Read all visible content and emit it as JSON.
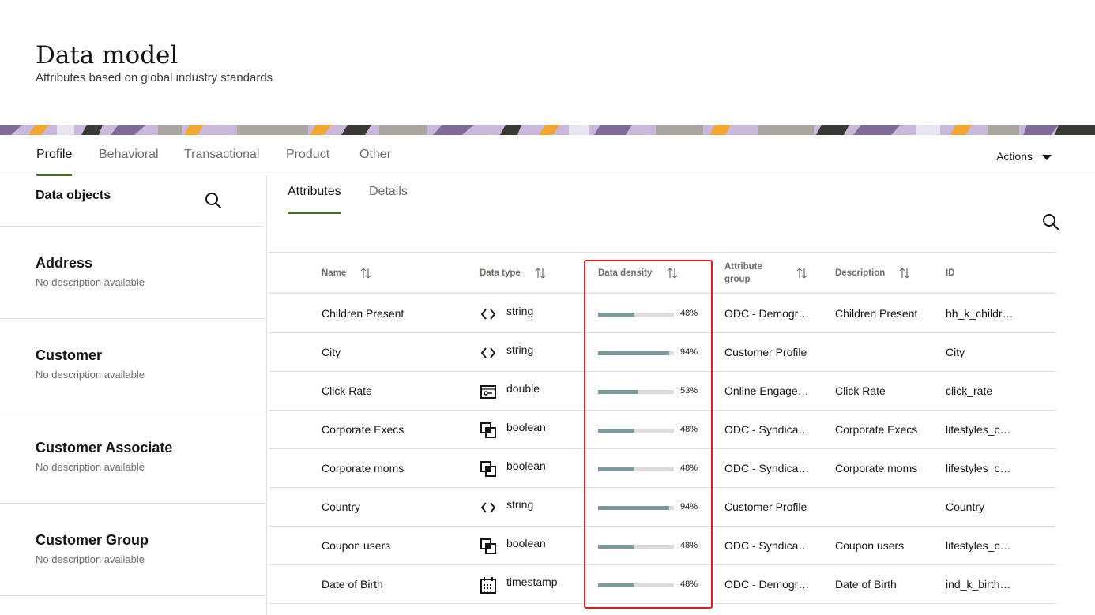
{
  "header": {
    "title": "Data model",
    "subtitle": "Attributes based on global industry standards"
  },
  "top_tabs": [
    {
      "label": "Profile",
      "active": true
    },
    {
      "label": "Behavioral",
      "active": false
    },
    {
      "label": "Transactional",
      "active": false
    },
    {
      "label": "Product",
      "active": false
    },
    {
      "label": "Other",
      "active": false
    }
  ],
  "actions_label": "Actions",
  "sidebar": {
    "title": "Data objects",
    "items": [
      {
        "name": "Address",
        "description": "No description available"
      },
      {
        "name": "Customer",
        "description": "No description available"
      },
      {
        "name": "Customer Associate",
        "description": "No description available"
      },
      {
        "name": "Customer Group",
        "description": "No description available"
      }
    ]
  },
  "sub_tabs": [
    {
      "label": "Attributes",
      "active": true
    },
    {
      "label": "Details",
      "active": false
    }
  ],
  "table": {
    "columns": {
      "name": "Name",
      "data_type": "Data type",
      "data_density": "Data density",
      "attribute_group_1": "Attribute",
      "attribute_group_2": "group",
      "description": "Description",
      "id": "ID"
    },
    "rows": [
      {
        "name": "Children Present",
        "type": "string",
        "type_icon": "code-icon",
        "density": 48,
        "density_label": "48%",
        "group": "ODC - Demogr…",
        "description": "Children Present",
        "id": "hh_k_childr…"
      },
      {
        "name": "City",
        "type": "string",
        "type_icon": "code-icon",
        "density": 94,
        "density_label": "94%",
        "group": "Customer Profile",
        "description": "",
        "id": "City"
      },
      {
        "name": "Click Rate",
        "type": "double",
        "type_icon": "number-icon",
        "density": 53,
        "density_label": "53%",
        "group": "Online Engage…",
        "description": "Click Rate",
        "id": "click_rate"
      },
      {
        "name": "Corporate Execs",
        "type": "boolean",
        "type_icon": "boolean-icon",
        "density": 48,
        "density_label": "48%",
        "group": "ODC - Syndica…",
        "description": "Corporate Execs",
        "id": "lifestyles_c…"
      },
      {
        "name": "Corporate moms",
        "type": "boolean",
        "type_icon": "boolean-icon",
        "density": 48,
        "density_label": "48%",
        "group": "ODC - Syndica…",
        "description": "Corporate moms",
        "id": "lifestyles_c…"
      },
      {
        "name": "Country",
        "type": "string",
        "type_icon": "code-icon",
        "density": 94,
        "density_label": "94%",
        "group": "Customer Profile",
        "description": "",
        "id": "Country"
      },
      {
        "name": "Coupon users",
        "type": "boolean",
        "type_icon": "boolean-icon",
        "density": 48,
        "density_label": "48%",
        "group": "ODC - Syndica…",
        "description": "Coupon users",
        "id": "lifestyles_c…"
      },
      {
        "name": "Date of Birth",
        "type": "timestamp",
        "type_icon": "calendar-icon",
        "density": 48,
        "density_label": "48%",
        "group": "ODC - Demogr…",
        "description": "Date of Birth",
        "id": "ind_k_birth…"
      }
    ]
  },
  "colors": {
    "accent": "#4f6b33",
    "density_bar": "#7d999c",
    "highlight": "#e01a1a"
  }
}
